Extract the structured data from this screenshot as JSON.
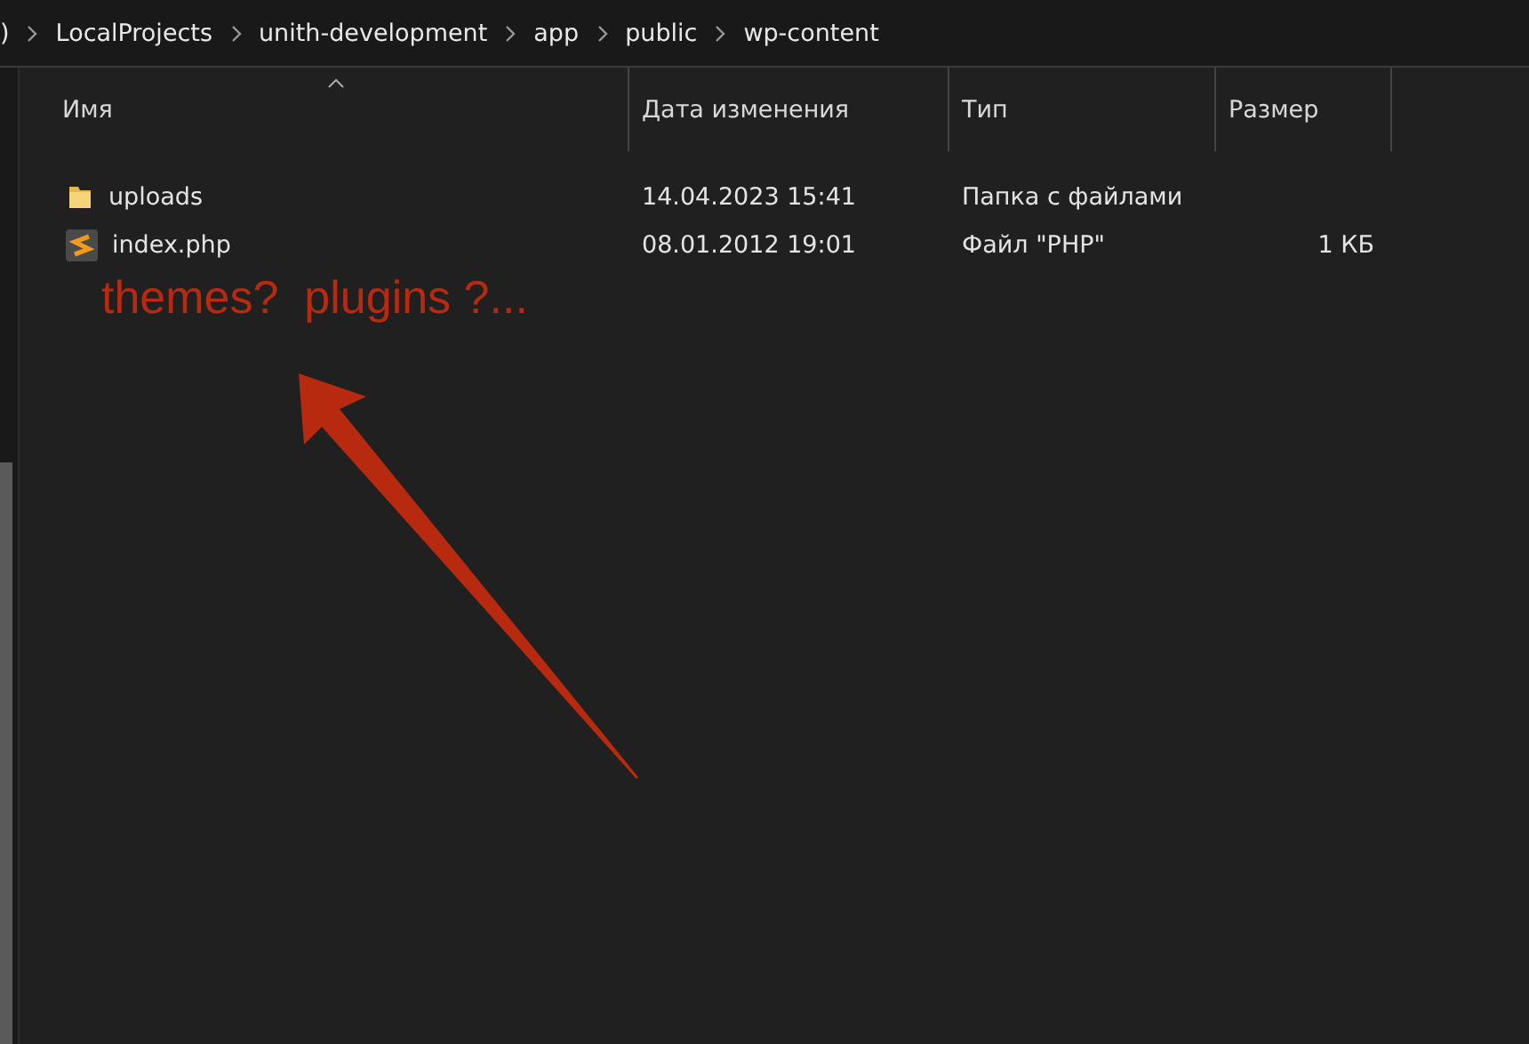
{
  "breadcrumb": [
    ")",
    "LocalProjects",
    "unith-development",
    "app",
    "public",
    "wp-content"
  ],
  "table": {
    "columns": [
      {
        "label": "Имя",
        "sorted": true
      },
      {
        "label": "Дата изменения",
        "sorted": false
      },
      {
        "label": "Тип",
        "sorted": false
      },
      {
        "label": "Размер",
        "sorted": false
      }
    ],
    "rows": [
      {
        "kind": "folder",
        "name": "uploads",
        "date": "14.04.2023 15:41",
        "type": "Папка с файлами"
      },
      {
        "kind": "php",
        "name": "index.php",
        "date": "08.01.2012 19:01",
        "type": "Файл \"PHP\"",
        "size": "1 КБ"
      }
    ]
  },
  "annotation": {
    "text": "themes?  plugins ?..."
  }
}
